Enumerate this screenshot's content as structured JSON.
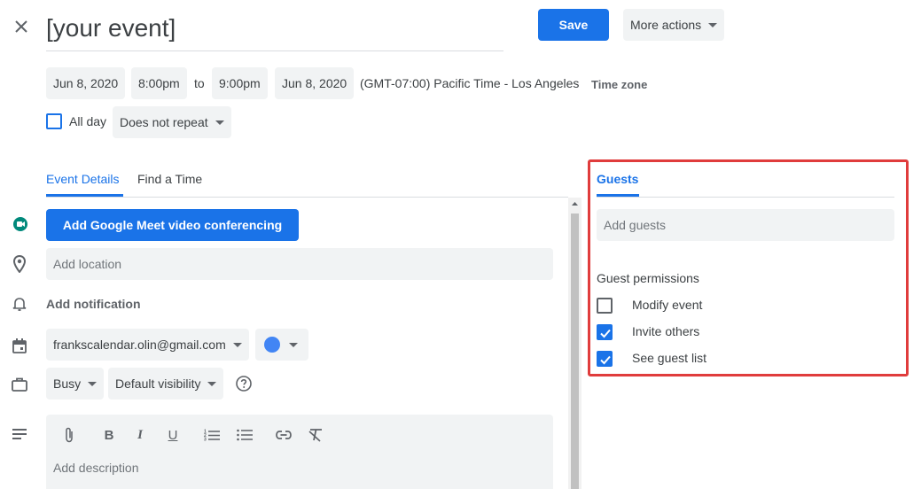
{
  "header": {
    "title": "[your event]",
    "save_label": "Save",
    "more_actions_label": "More actions"
  },
  "datetime": {
    "start_date": "Jun 8, 2020",
    "start_time": "8:00pm",
    "to_label": "to",
    "end_time": "9:00pm",
    "end_date": "Jun 8, 2020",
    "timezone_display": "(GMT-07:00) Pacific Time - Los Angeles",
    "timezone_button": "Time zone"
  },
  "allday": {
    "label": "All day",
    "checked": false,
    "repeat_value": "Does not repeat"
  },
  "tabs": [
    {
      "label": "Event Details",
      "active": true
    },
    {
      "label": "Find a Time",
      "active": false
    }
  ],
  "details": {
    "meet_button": "Add Google Meet video conferencing",
    "location_placeholder": "Add location",
    "notification_label": "Add notification",
    "calendar_value": "frankscalendar.olin@gmail.com",
    "event_color": "#4285f4",
    "busy_value": "Busy",
    "visibility_value": "Default visibility",
    "description_placeholder": "Add description"
  },
  "guests": {
    "tab_label": "Guests",
    "add_placeholder": "Add guests",
    "permissions_title": "Guest permissions",
    "permissions": [
      {
        "label": "Modify event",
        "checked": false
      },
      {
        "label": "Invite others",
        "checked": true
      },
      {
        "label": "See guest list",
        "checked": true
      }
    ],
    "highlight_color": "#e03c3c"
  },
  "colors": {
    "accent": "#1a73e8",
    "chip_bg": "#f1f3f4",
    "text": "#3c4043"
  }
}
